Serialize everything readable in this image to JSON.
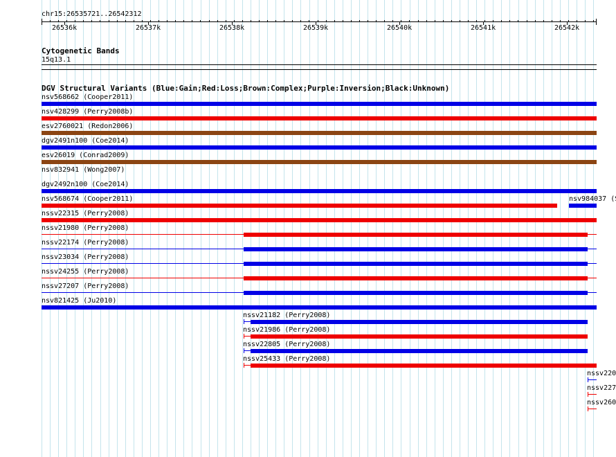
{
  "ruler": {
    "coordinate_label": "chr15:26535721..26542312",
    "start": 26535721,
    "end": 26542312,
    "tick_labels": [
      "26536k",
      "26537k",
      "26538k",
      "26539k",
      "26540k",
      "26541k",
      "26542k"
    ]
  },
  "cytoband": {
    "title": "Cytogenetic Bands",
    "band": "15q13.1"
  },
  "dgv": {
    "title": "DGV Structural Variants (Blue:Gain;Red:Loss;Brown:Complex;Purple:Inversion;Black:Unknown)",
    "colors": {
      "gain": "#0000e6",
      "loss": "#ee0000",
      "complex": "#8b4513"
    },
    "variants": [
      {
        "label": "nsv568662 (Cooper2011)",
        "type": "gain"
      },
      {
        "label": "nsv428299 (Perry2008b)",
        "type": "loss"
      },
      {
        "label": "esv2760021 (Redon2006)",
        "type": "complex"
      },
      {
        "label": "dgv2491n100 (Coe2014)",
        "type": "gain"
      },
      {
        "label": "esv26019 (Conrad2009)",
        "type": "complex"
      },
      {
        "label": "nsv832941 (Wong2007)",
        "type": "loss"
      },
      {
        "label": "dgv2492n100 (Coe2014)",
        "type": "gain"
      },
      {
        "label": "nsv568674 (Cooper2011)",
        "type": "loss"
      },
      {
        "label": "nsv984037 (S",
        "type": "gain"
      },
      {
        "label": "nssv22315 (Perry2008)",
        "type": "loss"
      },
      {
        "label": "nssv21980 (Perry2008)",
        "type": "loss"
      },
      {
        "label": "nssv22174 (Perry2008)",
        "type": "gain"
      },
      {
        "label": "nssv23034 (Perry2008)",
        "type": "gain"
      },
      {
        "label": "nssv24255 (Perry2008)",
        "type": "loss"
      },
      {
        "label": "nssv27207 (Perry2008)",
        "type": "gain"
      },
      {
        "label": "nsv821425 (Ju2010)",
        "type": "gain"
      },
      {
        "label": "nssv21182 (Perry2008)",
        "type": "gain"
      },
      {
        "label": "nssv21986 (Perry2008)",
        "type": "loss"
      },
      {
        "label": "nssv22805 (Perry2008)",
        "type": "gain"
      },
      {
        "label": "nssv25433 (Perry2008)",
        "type": "loss"
      },
      {
        "label": "nssv220",
        "type": "gain"
      },
      {
        "label": "nssv227",
        "type": "loss"
      },
      {
        "label": "nssv260",
        "type": "loss"
      }
    ]
  }
}
